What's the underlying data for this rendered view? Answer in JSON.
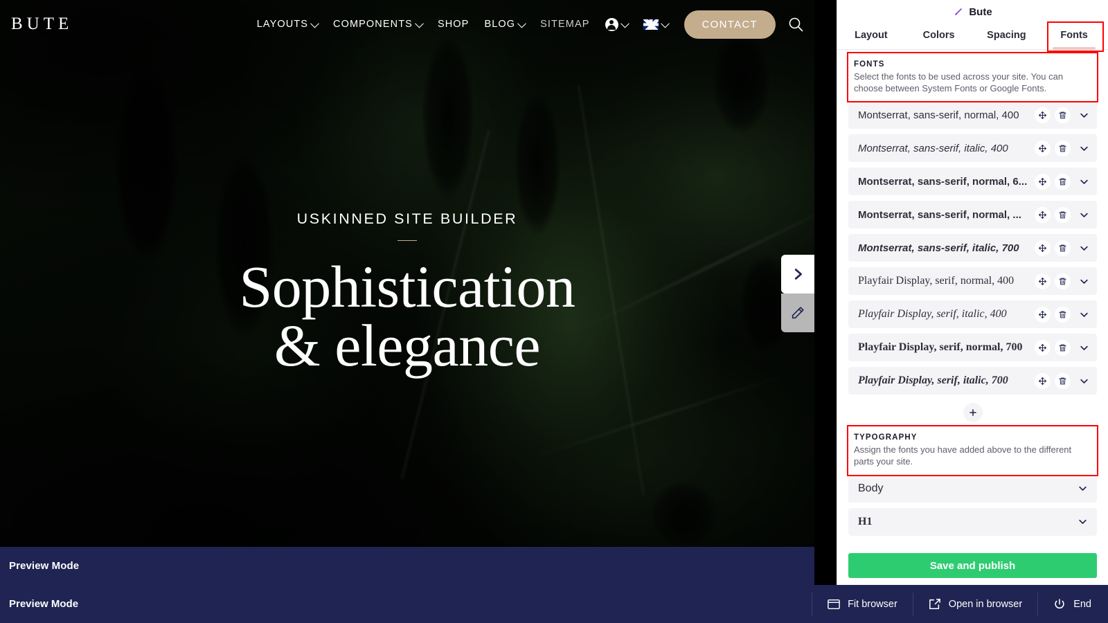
{
  "preview_site": {
    "brand": "BUTE",
    "nav": [
      {
        "label": "LAYOUTS",
        "caret": true,
        "dim": false
      },
      {
        "label": "COMPONENTS",
        "caret": true,
        "dim": false
      },
      {
        "label": "SHOP",
        "caret": false,
        "dim": false
      },
      {
        "label": "BLOG",
        "caret": true,
        "dim": false
      },
      {
        "label": "SITEMAP",
        "caret": false,
        "dim": true
      }
    ],
    "account_icon": "account-circle-icon",
    "language_flag": "uk-flag-icon",
    "contact_label": "CONTACT",
    "search_icon": "search-icon",
    "hero": {
      "kicker": "USKINNED SITE BUILDER",
      "title_line1": "Sophistication",
      "title_line2": "& elegance"
    },
    "edge_tabs": [
      {
        "name": "expand-panel-chevron",
        "icon": "chevron-right-icon"
      },
      {
        "name": "edit-pencil",
        "icon": "pencil-icon"
      }
    ],
    "preview_bar_label": "Preview Mode"
  },
  "panel": {
    "title": "Bute",
    "title_icon": "paintbrush-icon",
    "tabs": [
      {
        "label": "Layout",
        "active": false
      },
      {
        "label": "Colors",
        "active": false
      },
      {
        "label": "Spacing",
        "active": false
      },
      {
        "label": "Fonts",
        "active": true
      }
    ],
    "fonts_section": {
      "heading": "FONTS",
      "description": "Select the fonts to be used across your site. You can choose between System Fonts or Google Fonts.",
      "items": [
        {
          "label": "Montserrat, sans-serif, normal, 400",
          "family": "sans",
          "style": "normal",
          "weight": "400"
        },
        {
          "label": "Montserrat, sans-serif, italic, 400",
          "family": "sans",
          "style": "italic",
          "weight": "400"
        },
        {
          "label": "Montserrat, sans-serif, normal, 6...",
          "family": "sans",
          "style": "normal",
          "weight": "700"
        },
        {
          "label": "Montserrat, sans-serif, normal, ...",
          "family": "sans",
          "style": "normal",
          "weight": "700"
        },
        {
          "label": "Montserrat, sans-serif, italic, 700",
          "family": "sans",
          "style": "italic",
          "weight": "700"
        },
        {
          "label": "Playfair Display, serif, normal, 400",
          "family": "serif",
          "style": "normal",
          "weight": "400"
        },
        {
          "label": "Playfair Display, serif, italic, 400",
          "family": "serif",
          "style": "italic",
          "weight": "400"
        },
        {
          "label": "Playfair Display, serif, normal, 700",
          "family": "serif",
          "style": "normal",
          "weight": "700"
        },
        {
          "label": "Playfair Display, serif, italic, 700",
          "family": "serif",
          "style": "italic",
          "weight": "700"
        }
      ],
      "row_icons": {
        "move": "move-handle-icon",
        "delete": "trash-icon",
        "expand": "chevron-down-icon"
      },
      "add_icon": "plus-icon"
    },
    "typography_section": {
      "heading": "TYPOGRAPHY",
      "description": "Assign the fonts you have added above to the different parts your site.",
      "items": [
        {
          "label": "Body"
        },
        {
          "label": "H1"
        }
      ]
    },
    "publish_label": "Save and publish"
  },
  "os_bar": {
    "mode_label": "Preview Mode",
    "actions": [
      {
        "label": "Fit browser",
        "icon": "browser-window-icon"
      },
      {
        "label": "Open in browser",
        "icon": "external-link-icon"
      },
      {
        "label": "End",
        "icon": "power-icon"
      }
    ]
  },
  "colors": {
    "accent_gold": "#c3ad8d",
    "panel_bg": "#ffffff",
    "row_bg": "#f4f4f6",
    "publish_green": "#2ecc71",
    "os_bar_navy": "#1f2452",
    "highlight_red": "#ff0000",
    "tab_underline": "#f7c6c0",
    "brush_purple": "#7b3fe4"
  }
}
